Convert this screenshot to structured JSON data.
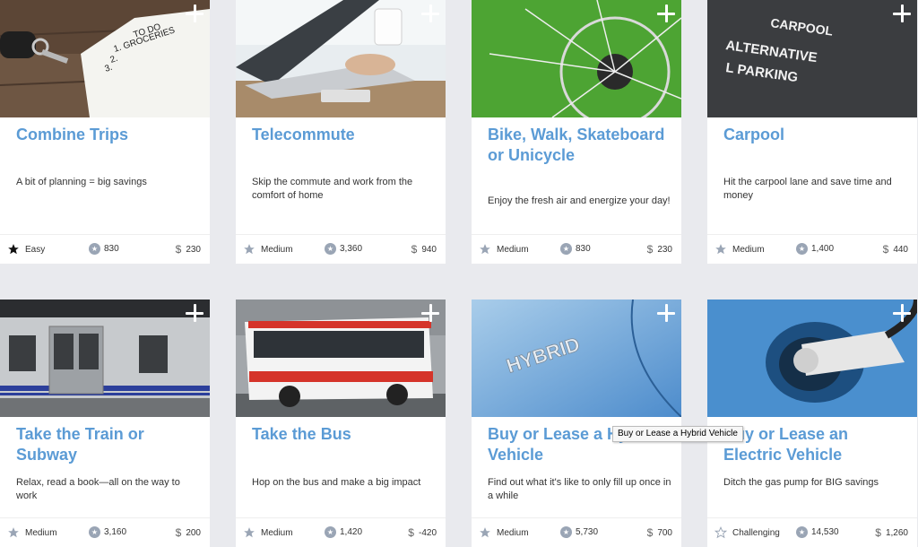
{
  "cards": [
    {
      "title": "Combine Trips",
      "description": "A bit of planning = big savings",
      "difficulty": "Easy",
      "points": "830",
      "cost": "230"
    },
    {
      "title": "Telecommute",
      "description": "Skip the commute and work from the comfort of home",
      "difficulty": "Medium",
      "points": "3,360",
      "cost": "940"
    },
    {
      "title": "Bike, Walk, Skateboard or Unicycle",
      "description": "Enjoy the fresh air and energize your day!",
      "difficulty": "Medium",
      "points": "830",
      "cost": "230"
    },
    {
      "title": "Carpool",
      "description": "Hit the carpool lane and save time and money",
      "difficulty": "Medium",
      "points": "1,400",
      "cost": "440"
    },
    {
      "title": "Take the Train or Subway",
      "description": "Relax, read a book—all on the way to work",
      "difficulty": "Medium",
      "points": "3,160",
      "cost": "200"
    },
    {
      "title": "Take the Bus",
      "description": "Hop on the bus and make a big impact",
      "difficulty": "Medium",
      "points": "1,420",
      "cost": "-420"
    },
    {
      "title": "Buy or Lease a Hybrid Vehicle",
      "description": "Find out what it's like to only fill up once in a while",
      "difficulty": "Medium",
      "points": "5,730",
      "cost": "700"
    },
    {
      "title": "Buy or Lease an Electric Vehicle",
      "description": "Ditch the gas pump for BIG savings",
      "difficulty": "Challenging",
      "points": "14,530",
      "cost": "1,260"
    }
  ],
  "images": {
    "todo_note": [
      "TO DO",
      "1. GROCERIES",
      "2.",
      "3."
    ],
    "carpool_sign": [
      "CARPOOL",
      "ALTERNATIVE",
      "L PARKING"
    ],
    "hybrid_badge": "HYBRID"
  },
  "tooltip": "Buy or Lease a Hybrid Vehicle",
  "currency_symbol": "$",
  "colors": {
    "accent": "#5b9bd5",
    "background": "#e9eaee",
    "star_gray": "#9aa5b5"
  }
}
